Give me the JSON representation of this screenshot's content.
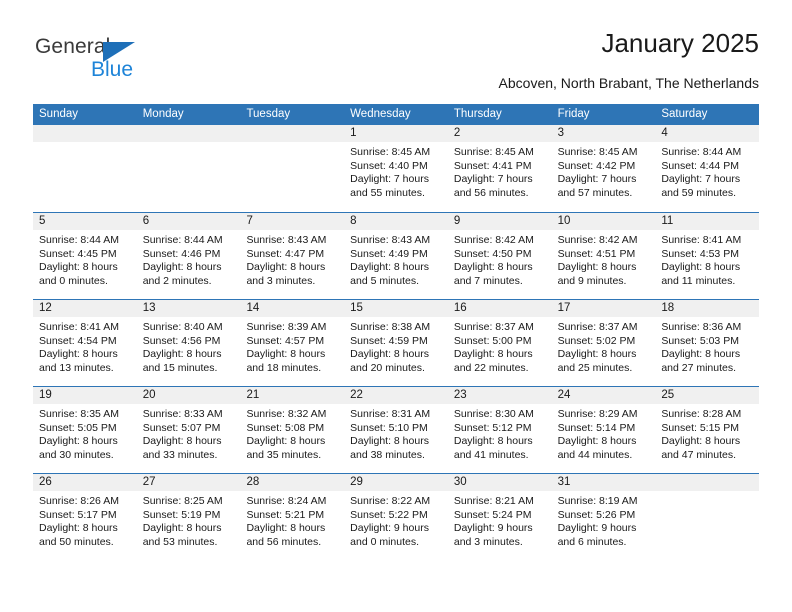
{
  "logo": {
    "primary_text": "General",
    "secondary_text": "Blue",
    "primary_color": "#3a3a3a",
    "secondary_color": "#1e84d8",
    "triangle_color": "#1e6fb8"
  },
  "header": {
    "title": "January 2025",
    "subtitle": "Abcoven, North Brabant, The Netherlands"
  },
  "calendar": {
    "header_background": "#2e75b6",
    "header_text_color": "#ffffff",
    "day_band_background": "#f0f0f0",
    "weekdays": [
      "Sunday",
      "Monday",
      "Tuesday",
      "Wednesday",
      "Thursday",
      "Friday",
      "Saturday"
    ],
    "weeks": [
      [
        {
          "day": "",
          "empty": true
        },
        {
          "day": "",
          "empty": true
        },
        {
          "day": "",
          "empty": true
        },
        {
          "day": "1",
          "sunrise": "Sunrise: 8:45 AM",
          "sunset": "Sunset: 4:40 PM",
          "daylight_line1": "Daylight: 7 hours",
          "daylight_line2": "and 55 minutes."
        },
        {
          "day": "2",
          "sunrise": "Sunrise: 8:45 AM",
          "sunset": "Sunset: 4:41 PM",
          "daylight_line1": "Daylight: 7 hours",
          "daylight_line2": "and 56 minutes."
        },
        {
          "day": "3",
          "sunrise": "Sunrise: 8:45 AM",
          "sunset": "Sunset: 4:42 PM",
          "daylight_line1": "Daylight: 7 hours",
          "daylight_line2": "and 57 minutes."
        },
        {
          "day": "4",
          "sunrise": "Sunrise: 8:44 AM",
          "sunset": "Sunset: 4:44 PM",
          "daylight_line1": "Daylight: 7 hours",
          "daylight_line2": "and 59 minutes."
        }
      ],
      [
        {
          "day": "5",
          "sunrise": "Sunrise: 8:44 AM",
          "sunset": "Sunset: 4:45 PM",
          "daylight_line1": "Daylight: 8 hours",
          "daylight_line2": "and 0 minutes."
        },
        {
          "day": "6",
          "sunrise": "Sunrise: 8:44 AM",
          "sunset": "Sunset: 4:46 PM",
          "daylight_line1": "Daylight: 8 hours",
          "daylight_line2": "and 2 minutes."
        },
        {
          "day": "7",
          "sunrise": "Sunrise: 8:43 AM",
          "sunset": "Sunset: 4:47 PM",
          "daylight_line1": "Daylight: 8 hours",
          "daylight_line2": "and 3 minutes."
        },
        {
          "day": "8",
          "sunrise": "Sunrise: 8:43 AM",
          "sunset": "Sunset: 4:49 PM",
          "daylight_line1": "Daylight: 8 hours",
          "daylight_line2": "and 5 minutes."
        },
        {
          "day": "9",
          "sunrise": "Sunrise: 8:42 AM",
          "sunset": "Sunset: 4:50 PM",
          "daylight_line1": "Daylight: 8 hours",
          "daylight_line2": "and 7 minutes."
        },
        {
          "day": "10",
          "sunrise": "Sunrise: 8:42 AM",
          "sunset": "Sunset: 4:51 PM",
          "daylight_line1": "Daylight: 8 hours",
          "daylight_line2": "and 9 minutes."
        },
        {
          "day": "11",
          "sunrise": "Sunrise: 8:41 AM",
          "sunset": "Sunset: 4:53 PM",
          "daylight_line1": "Daylight: 8 hours",
          "daylight_line2": "and 11 minutes."
        }
      ],
      [
        {
          "day": "12",
          "sunrise": "Sunrise: 8:41 AM",
          "sunset": "Sunset: 4:54 PM",
          "daylight_line1": "Daylight: 8 hours",
          "daylight_line2": "and 13 minutes."
        },
        {
          "day": "13",
          "sunrise": "Sunrise: 8:40 AM",
          "sunset": "Sunset: 4:56 PM",
          "daylight_line1": "Daylight: 8 hours",
          "daylight_line2": "and 15 minutes."
        },
        {
          "day": "14",
          "sunrise": "Sunrise: 8:39 AM",
          "sunset": "Sunset: 4:57 PM",
          "daylight_line1": "Daylight: 8 hours",
          "daylight_line2": "and 18 minutes."
        },
        {
          "day": "15",
          "sunrise": "Sunrise: 8:38 AM",
          "sunset": "Sunset: 4:59 PM",
          "daylight_line1": "Daylight: 8 hours",
          "daylight_line2": "and 20 minutes."
        },
        {
          "day": "16",
          "sunrise": "Sunrise: 8:37 AM",
          "sunset": "Sunset: 5:00 PM",
          "daylight_line1": "Daylight: 8 hours",
          "daylight_line2": "and 22 minutes."
        },
        {
          "day": "17",
          "sunrise": "Sunrise: 8:37 AM",
          "sunset": "Sunset: 5:02 PM",
          "daylight_line1": "Daylight: 8 hours",
          "daylight_line2": "and 25 minutes."
        },
        {
          "day": "18",
          "sunrise": "Sunrise: 8:36 AM",
          "sunset": "Sunset: 5:03 PM",
          "daylight_line1": "Daylight: 8 hours",
          "daylight_line2": "and 27 minutes."
        }
      ],
      [
        {
          "day": "19",
          "sunrise": "Sunrise: 8:35 AM",
          "sunset": "Sunset: 5:05 PM",
          "daylight_line1": "Daylight: 8 hours",
          "daylight_line2": "and 30 minutes."
        },
        {
          "day": "20",
          "sunrise": "Sunrise: 8:33 AM",
          "sunset": "Sunset: 5:07 PM",
          "daylight_line1": "Daylight: 8 hours",
          "daylight_line2": "and 33 minutes."
        },
        {
          "day": "21",
          "sunrise": "Sunrise: 8:32 AM",
          "sunset": "Sunset: 5:08 PM",
          "daylight_line1": "Daylight: 8 hours",
          "daylight_line2": "and 35 minutes."
        },
        {
          "day": "22",
          "sunrise": "Sunrise: 8:31 AM",
          "sunset": "Sunset: 5:10 PM",
          "daylight_line1": "Daylight: 8 hours",
          "daylight_line2": "and 38 minutes."
        },
        {
          "day": "23",
          "sunrise": "Sunrise: 8:30 AM",
          "sunset": "Sunset: 5:12 PM",
          "daylight_line1": "Daylight: 8 hours",
          "daylight_line2": "and 41 minutes."
        },
        {
          "day": "24",
          "sunrise": "Sunrise: 8:29 AM",
          "sunset": "Sunset: 5:14 PM",
          "daylight_line1": "Daylight: 8 hours",
          "daylight_line2": "and 44 minutes."
        },
        {
          "day": "25",
          "sunrise": "Sunrise: 8:28 AM",
          "sunset": "Sunset: 5:15 PM",
          "daylight_line1": "Daylight: 8 hours",
          "daylight_line2": "and 47 minutes."
        }
      ],
      [
        {
          "day": "26",
          "sunrise": "Sunrise: 8:26 AM",
          "sunset": "Sunset: 5:17 PM",
          "daylight_line1": "Daylight: 8 hours",
          "daylight_line2": "and 50 minutes."
        },
        {
          "day": "27",
          "sunrise": "Sunrise: 8:25 AM",
          "sunset": "Sunset: 5:19 PM",
          "daylight_line1": "Daylight: 8 hours",
          "daylight_line2": "and 53 minutes."
        },
        {
          "day": "28",
          "sunrise": "Sunrise: 8:24 AM",
          "sunset": "Sunset: 5:21 PM",
          "daylight_line1": "Daylight: 8 hours",
          "daylight_line2": "and 56 minutes."
        },
        {
          "day": "29",
          "sunrise": "Sunrise: 8:22 AM",
          "sunset": "Sunset: 5:22 PM",
          "daylight_line1": "Daylight: 9 hours",
          "daylight_line2": "and 0 minutes."
        },
        {
          "day": "30",
          "sunrise": "Sunrise: 8:21 AM",
          "sunset": "Sunset: 5:24 PM",
          "daylight_line1": "Daylight: 9 hours",
          "daylight_line2": "and 3 minutes."
        },
        {
          "day": "31",
          "sunrise": "Sunrise: 8:19 AM",
          "sunset": "Sunset: 5:26 PM",
          "daylight_line1": "Daylight: 9 hours",
          "daylight_line2": "and 6 minutes."
        },
        {
          "day": "",
          "empty": true
        }
      ]
    ]
  }
}
